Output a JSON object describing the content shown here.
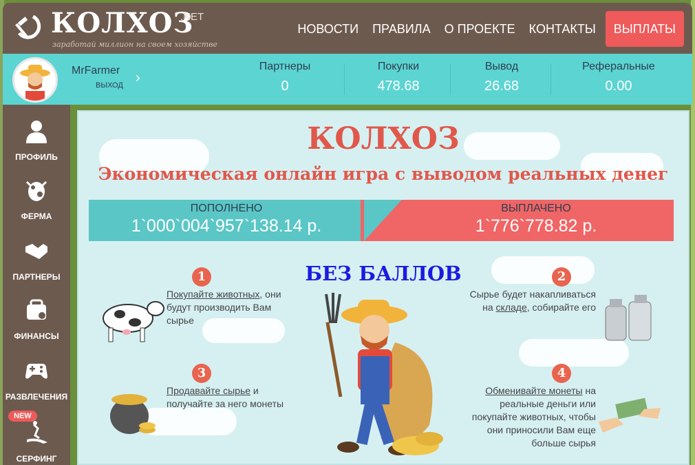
{
  "header": {
    "logo_title": "КОЛХОЗ",
    "logo_net": ".NET",
    "tagline": "заработай миллион на своем хозяйстве",
    "nav": [
      "НОВОСТИ",
      "ПРАВИЛА",
      "О ПРОЕКТЕ",
      "КОНТАКТЫ",
      "ВЫПЛАТЫ"
    ]
  },
  "user": {
    "name": "MrFarmer",
    "exit": "ВЫХОД"
  },
  "stats": [
    {
      "label": "Партнеры",
      "value": "0"
    },
    {
      "label": "Покупки",
      "value": "478.68"
    },
    {
      "label": "Вывод",
      "value": "26.68"
    },
    {
      "label": "Реферальные",
      "value": "0.00"
    }
  ],
  "sidebar": {
    "items": [
      "ПРОФИЛЬ",
      "ФЕРМА",
      "ПАРТНЕРЫ",
      "ФИНАНСЫ",
      "РАЗВЛЕЧЕНИЯ",
      "СЕРФИНГ"
    ],
    "new_badge": "NEW"
  },
  "main": {
    "title": "КОЛХОЗ",
    "subtitle": "Экономическая онлайн игра с выводом реальных денег",
    "deposited_label": "ПОПОЛНЕНО",
    "deposited_value": "1`000`004`957`138.14 р.",
    "paid_label": "ВЫПЛАЧЕНО",
    "paid_value": "1`776`778.82 р.",
    "no_points": "БЕЗ БАЛЛОВ",
    "steps": [
      {
        "num": "1",
        "link": "Покупайте животных",
        "rest": ", они будут производить Вам сырье"
      },
      {
        "num": "2",
        "pre": "Сырье будет накапливаться на ",
        "link": "складе",
        "rest": ", собирайте его"
      },
      {
        "num": "3",
        "link": "Продавайте сырье",
        "rest": " и получайте за него монеты"
      },
      {
        "num": "4",
        "link": "Обменивайте монеты",
        "rest": " на реальные деньги или покупайте животных, чтобы они приносили Вам еще больше сырья"
      }
    ]
  },
  "colors": {
    "header_bg": "#6d5a4f",
    "stats_bg": "#5cd4d2",
    "accent_red": "#ef5a5a",
    "title_red": "#e0584b",
    "teal": "#5bc6c6"
  }
}
